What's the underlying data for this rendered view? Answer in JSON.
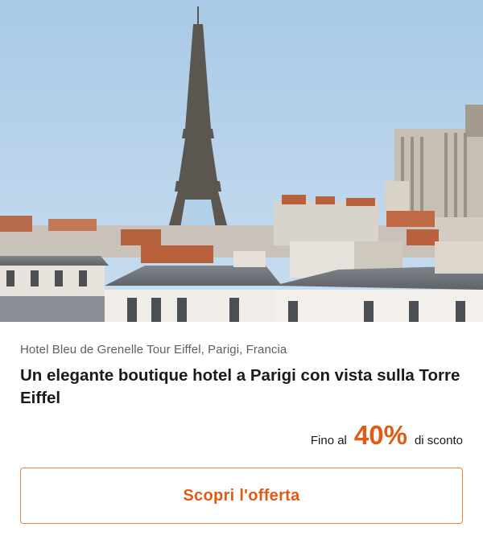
{
  "hero": {
    "image": "paris-rooftops-eiffel-tower-photo"
  },
  "hotel": {
    "location": "Hotel Bleu de Grenelle Tour Eiffel, Parigi, Francia",
    "title": "Un elegante boutique hotel a Parigi con vista sulla Torre Eiffel"
  },
  "discount": {
    "prefix": "Fino al",
    "value": "40%",
    "suffix": "di sconto"
  },
  "cta": {
    "label": "Scopri l'offerta"
  },
  "colors": {
    "accent": "#e35b12",
    "border": "#e8853f",
    "text": "#1a1a1a",
    "muted": "#5f5f5f",
    "sky": "#b4d1ea"
  }
}
